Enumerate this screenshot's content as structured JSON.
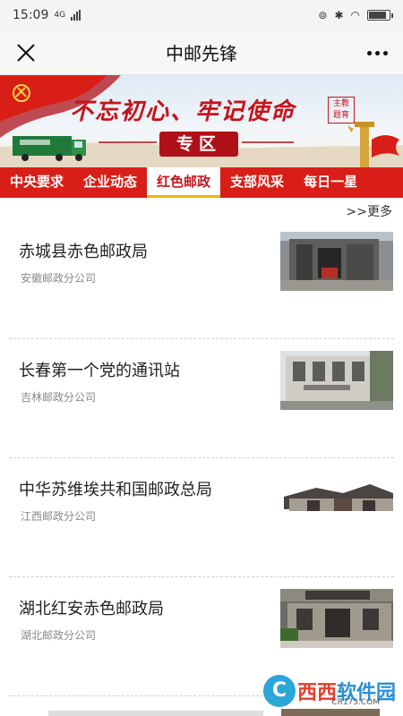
{
  "status": {
    "time": "15:09",
    "network": "4G",
    "battery_level": 0.85
  },
  "header": {
    "title": "中邮先锋"
  },
  "banner": {
    "slogan": "不忘初心、牢记使命",
    "stamp": "主教\n题育",
    "zone_label": "专区"
  },
  "tabs": [
    {
      "label": "中央要求"
    },
    {
      "label": "企业动态"
    },
    {
      "label": "红色邮政"
    },
    {
      "label": "支部风采"
    },
    {
      "label": "每日一星"
    }
  ],
  "active_tab": "红色邮政",
  "more_link": ">>更多",
  "articles": [
    {
      "title": "赤城县赤色邮政局",
      "source": "安徽邮政分公司"
    },
    {
      "title": "长春第一个党的通讯站",
      "source": "吉林邮政分公司"
    },
    {
      "title": "中华苏维埃共和国邮政总局",
      "source": "江西邮政分公司"
    },
    {
      "title": "湖北红安赤色邮政局",
      "source": "湖北邮政分公司"
    }
  ],
  "watermark": {
    "name_a": "西西",
    "name_b": "软件园",
    "url": "CR173.COM"
  },
  "colors": {
    "accent_red": "#d81e16",
    "active_tab_underline": "#f0b400"
  }
}
